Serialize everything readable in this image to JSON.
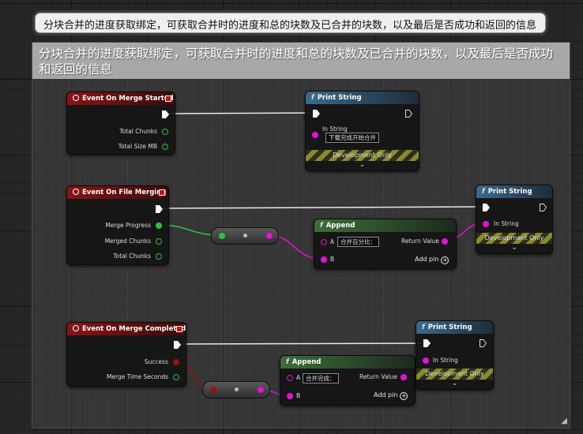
{
  "top_comment": "分块合并的进度获取绑定，可获取合并时的进度和总的块数及已合并的块数，以及最后是否成功和返回的信息",
  "group_comment": "分块合并的进度获取绑定，可获取合并时的进度和总的块数及已合并的块数，以及最后是否成功和返回的信息",
  "colors": {
    "exec": "#ffffff",
    "float_pin": "#2ec04a",
    "string_pin": "#e212d6",
    "bool_pin": "#9b1010",
    "event_header": "#8a1414",
    "function_header": "#3c6a8c",
    "append_header": "#3e6e3a"
  },
  "nodes": {
    "merge_started": {
      "title": "Event On Merge Started",
      "pins": [
        "Total Chunks",
        "Total Size MB"
      ]
    },
    "print1": {
      "title": "Print String",
      "in_string_label": "In String",
      "in_string_value": "下载完成开始合并",
      "dev_only": "Development Only"
    },
    "file_merging": {
      "title": "Event On File Merging",
      "pins": [
        "Merge Progress",
        "Merged Chunks",
        "Total Chunks"
      ]
    },
    "append1": {
      "title": "Append",
      "a_label": "A",
      "a_value": "合并百分比：",
      "b_label": "B",
      "return_label": "Return Value",
      "add_pin": "Add pin"
    },
    "print2": {
      "title": "Print String",
      "in_string_label": "In String",
      "dev_only": "Development Only"
    },
    "merge_completed": {
      "title": "Event On Merge Completed",
      "pins": [
        "Success",
        "Merge Time Seconds"
      ]
    },
    "append2": {
      "title": "Append",
      "a_label": "A",
      "a_value": "合并完成：",
      "b_label": "B",
      "return_label": "Return Value",
      "add_pin": "Add pin"
    },
    "print3": {
      "title": "Print String",
      "in_string_label": "In String",
      "dev_only": "Development Only"
    }
  },
  "icons": {
    "function": "f",
    "add": "+",
    "expand": "chevron-down",
    "resize": "resize-grip"
  }
}
